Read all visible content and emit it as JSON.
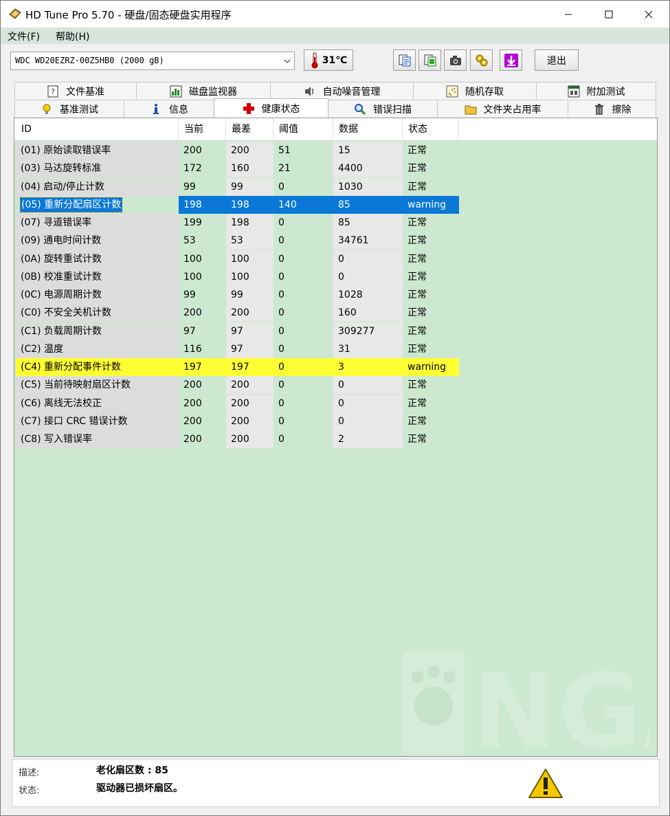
{
  "window": {
    "title": "HD Tune Pro 5.70 - 硬盘/固态硬盘实用程序",
    "minimize_icon": "minimize-icon",
    "maximize_icon": "maximize-icon",
    "close_icon": "close-icon"
  },
  "menu": {
    "file": "文件(F)",
    "help": "帮助(H)"
  },
  "toolbar": {
    "drive": "WDC WD20EZRZ-00Z5HB0 (2000 gB)",
    "temperature": "31℃",
    "exit_label": "退出",
    "icons": [
      "copy-text-icon",
      "copy-screenshot-icon",
      "camera-icon",
      "settings-icon",
      "save-icon"
    ]
  },
  "tabs": {
    "row1": [
      "文件基准",
      "磁盘监视器",
      "自动噪音管理",
      "随机存取",
      "附加测试"
    ],
    "row2": [
      "基准测试",
      "信息",
      "健康状态",
      "错误扫描",
      "文件夹占用率",
      "擦除"
    ],
    "active": "健康状态"
  },
  "table": {
    "headers": [
      "ID",
      "当前",
      "最差",
      "阈值",
      "数据",
      "状态"
    ],
    "rows": [
      [
        "(01) 原始读取错误率",
        "200",
        "200",
        "51",
        "15",
        "正常"
      ],
      [
        "(03) 马达旋转标准",
        "172",
        "160",
        "21",
        "4400",
        "正常"
      ],
      [
        "(04) 启动/停止计数",
        "99",
        "99",
        "0",
        "1030",
        "正常"
      ],
      [
        "(05) 重新分配扇区计数",
        "198",
        "198",
        "140",
        "85",
        "warning"
      ],
      [
        "(07) 寻道错误率",
        "199",
        "198",
        "0",
        "85",
        "正常"
      ],
      [
        "(09) 通电时间计数",
        "53",
        "53",
        "0",
        "34761",
        "正常"
      ],
      [
        "(0A) 旋转重试计数",
        "100",
        "100",
        "0",
        "0",
        "正常"
      ],
      [
        "(0B) 校准重试计数",
        "100",
        "100",
        "0",
        "0",
        "正常"
      ],
      [
        "(0C) 电源周期计数",
        "99",
        "99",
        "0",
        "1028",
        "正常"
      ],
      [
        "(C0) 不安全关机计数",
        "200",
        "200",
        "0",
        "160",
        "正常"
      ],
      [
        "(C1) 负载周期计数",
        "97",
        "97",
        "0",
        "309277",
        "正常"
      ],
      [
        "(C2) 温度",
        "116",
        "97",
        "0",
        "31",
        "正常"
      ],
      [
        "(C4) 重新分配事件计数",
        "197",
        "197",
        "0",
        "3",
        "warning"
      ],
      [
        "(C5) 当前待映射扇区计数",
        "200",
        "200",
        "0",
        "0",
        "正常"
      ],
      [
        "(C6) 离线无法校正",
        "200",
        "200",
        "0",
        "0",
        "正常"
      ],
      [
        "(C7) 接口 CRC 错误计数",
        "200",
        "200",
        "0",
        "0",
        "正常"
      ],
      [
        "(C8) 写入错误率",
        "200",
        "200",
        "0",
        "2",
        "正常"
      ]
    ],
    "selected_row": 3,
    "highlighted_row": 12
  },
  "watermark": "NGA",
  "footer": {
    "desc_label": "描述:",
    "desc_value": "老化扇区数  :  85",
    "status_label": "状态:",
    "status_value": "驱动器已损坏扇区。",
    "status_icon": "warning-triangle-icon"
  },
  "colors": {
    "panel_bg": "#cce8d0",
    "selected": "#0a78d7",
    "warning_row": "#ffff33",
    "menubar": "#d7e4dc"
  }
}
